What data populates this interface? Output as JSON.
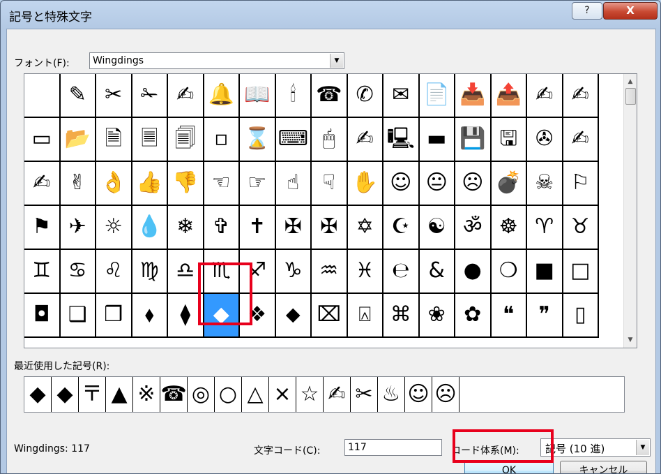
{
  "window": {
    "title": "記号と特殊文字",
    "help_label": "?",
    "close_label": "X"
  },
  "font": {
    "label": "フォント(F):",
    "value": "Wingdings"
  },
  "grid": {
    "cols": 21,
    "rows": [
      [
        " ",
        "✎",
        "✂",
        "✁",
        "✍",
        "🔔",
        "📖",
        "🕯",
        "☎",
        "✆",
        "✉",
        "📄",
        "📥",
        "📤",
        "✍",
        "✍"
      ],
      [
        "▭",
        "📂",
        "🗎",
        "🗏",
        "🗐",
        "▫",
        "⌛",
        "⌨",
        "🖱",
        "✍",
        "🖳",
        "▬",
        "💾",
        "🖫",
        "✇",
        "✍"
      ],
      [
        "✍",
        "✌",
        "👌",
        "👍",
        "👎",
        "☜",
        "☞",
        "☝",
        "☟",
        "✋",
        "☺",
        "😐",
        "☹",
        "💣",
        "☠",
        "⚐"
      ],
      [
        "⚑",
        "✈",
        "☼",
        "💧",
        "❄",
        "✞",
        "✝",
        "✠",
        "✠",
        "✡",
        "☪",
        "☯",
        "ॐ",
        "☸",
        "♈",
        "♉"
      ],
      [
        "♊",
        "♋",
        "♌",
        "♍",
        "♎",
        "♏",
        "♐",
        "♑",
        "♒",
        "♓",
        "℮",
        "&",
        "●",
        "❍",
        "■",
        "□"
      ],
      [
        "◘",
        "❑",
        "❒",
        "⬧",
        "⧫",
        "◆",
        "❖",
        "⬥",
        "⌧",
        "⍓",
        "⌘",
        "❀",
        "✿",
        "❝",
        "❞",
        "▯"
      ]
    ],
    "selected_row": 5,
    "selected_col": 5
  },
  "recent": {
    "label": "最近使用した記号(R):",
    "items": [
      "◆",
      "◆",
      "〒",
      "▲",
      "※",
      "☎",
      "◎",
      "○",
      "△",
      "×",
      "☆",
      "✍",
      "✂",
      "♨",
      "☺",
      "☹"
    ]
  },
  "info": "Wingdings: 117",
  "code": {
    "label": "文字コード(C):",
    "value": "117"
  },
  "system": {
    "label": "コード体系(M):",
    "value": "記号 (10 進)"
  },
  "buttons": {
    "ok": "OK",
    "cancel": "キャンセル"
  }
}
